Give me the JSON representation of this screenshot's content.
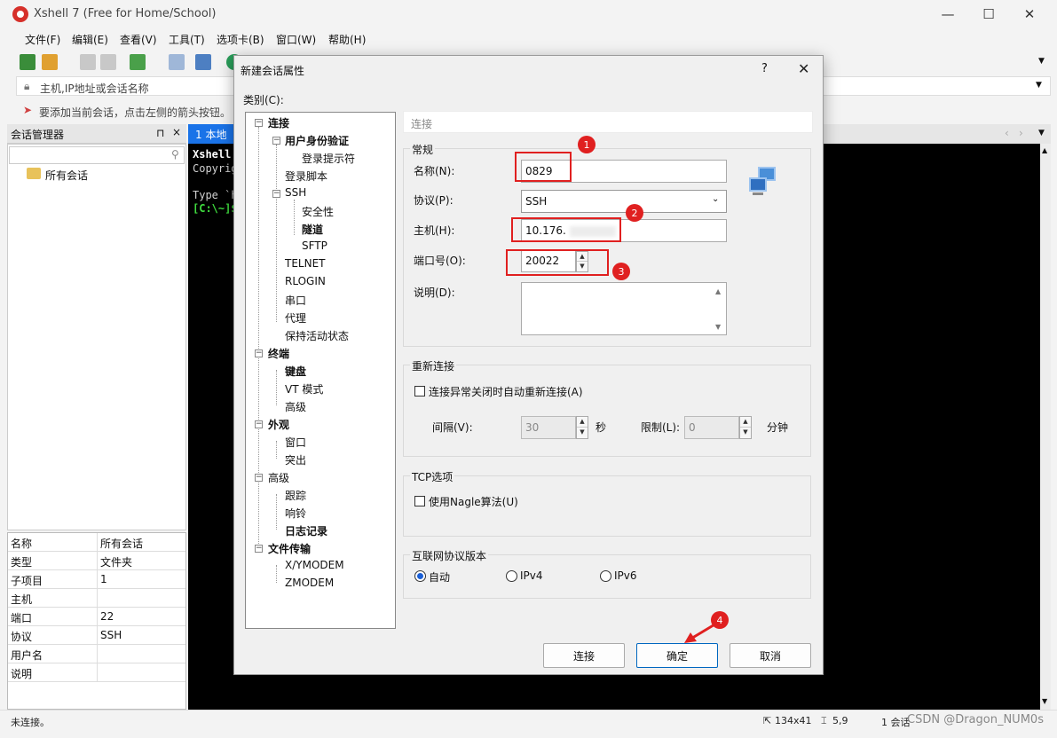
{
  "app": {
    "title": "Xshell 7 (Free for Home/School)",
    "menu": [
      "文件(F)",
      "编辑(E)",
      "查看(V)",
      "工具(T)",
      "选项卡(B)",
      "窗口(W)",
      "帮助(H)"
    ],
    "address_placeholder": "主机,IP地址或会话名称",
    "hint": "要添加当前会话，点击左侧的箭头按钮。"
  },
  "session_manager": {
    "title": "会话管理器",
    "pin": "⊓",
    "close": "×",
    "root": "所有会话",
    "props": [
      {
        "key": "名称",
        "value": "所有会话"
      },
      {
        "key": "类型",
        "value": "文件夹"
      },
      {
        "key": "子项目",
        "value": "1"
      },
      {
        "key": "主机",
        "value": ""
      },
      {
        "key": "端口",
        "value": "22"
      },
      {
        "key": "协议",
        "value": "SSH"
      },
      {
        "key": "用户名",
        "value": ""
      },
      {
        "key": "说明",
        "value": ""
      }
    ]
  },
  "terminal": {
    "tab": "1 本地",
    "lines": [
      "Xshell",
      "Copyrig",
      "",
      "Type `h",
      "[C:\\~]$"
    ]
  },
  "status": {
    "left": "未连接。",
    "size": "134x41",
    "pos": "5,9",
    "sessions": "1 会话",
    "watermark": "CSDN @Dragon_NUM0s",
    "num": "NUM"
  },
  "dialog": {
    "title": "新建会话属性",
    "help": "?",
    "close": "✕",
    "category_label": "类别(C):",
    "tree": [
      {
        "label": "连接",
        "level": 0,
        "bold": true,
        "box": "−"
      },
      {
        "label": "用户身份验证",
        "level": 1,
        "bold": true,
        "box": "−"
      },
      {
        "label": "登录提示符",
        "level": 2,
        "bold": false
      },
      {
        "label": "登录脚本",
        "level": 1,
        "bold": false
      },
      {
        "label": "SSH",
        "level": 1,
        "bold": false,
        "box": "−"
      },
      {
        "label": "安全性",
        "level": 2,
        "bold": false
      },
      {
        "label": "隧道",
        "level": 2,
        "bold": true
      },
      {
        "label": "SFTP",
        "level": 2,
        "bold": false
      },
      {
        "label": "TELNET",
        "level": 1,
        "bold": false
      },
      {
        "label": "RLOGIN",
        "level": 1,
        "bold": false
      },
      {
        "label": "串口",
        "level": 1,
        "bold": false
      },
      {
        "label": "代理",
        "level": 1,
        "bold": false
      },
      {
        "label": "保持活动状态",
        "level": 1,
        "bold": false
      },
      {
        "label": "终端",
        "level": 0,
        "bold": true,
        "box": "−"
      },
      {
        "label": "键盘",
        "level": 1,
        "bold": true
      },
      {
        "label": "VT 模式",
        "level": 1,
        "bold": false
      },
      {
        "label": "高级",
        "level": 1,
        "bold": false
      },
      {
        "label": "外观",
        "level": 0,
        "bold": true,
        "box": "−"
      },
      {
        "label": "窗口",
        "level": 1,
        "bold": false
      },
      {
        "label": "突出",
        "level": 1,
        "bold": false
      },
      {
        "label": "高级",
        "level": 0,
        "bold": false,
        "box": "−"
      },
      {
        "label": "跟踪",
        "level": 1,
        "bold": false
      },
      {
        "label": "响铃",
        "level": 1,
        "bold": false
      },
      {
        "label": "日志记录",
        "level": 1,
        "bold": true
      },
      {
        "label": "文件传输",
        "level": 0,
        "bold": true,
        "box": "−"
      },
      {
        "label": "X/YMODEM",
        "level": 1,
        "bold": false
      },
      {
        "label": "ZMODEM",
        "level": 1,
        "bold": false
      }
    ],
    "breadcrumb": "连接",
    "general": {
      "title": "常规",
      "name_label": "名称(N):",
      "name_value": "0829",
      "protocol_label": "协议(P):",
      "protocol_value": "SSH",
      "host_label": "主机(H):",
      "host_value": "10.176.",
      "port_label": "端口号(O):",
      "port_value": "20022",
      "desc_label": "说明(D):",
      "desc_value": ""
    },
    "reconnect": {
      "title": "重新连接",
      "checkbox": "连接异常关闭时自动重新连接(A)",
      "interval_label": "间隔(V):",
      "interval_value": "30",
      "interval_unit": "秒",
      "limit_label": "限制(L):",
      "limit_value": "0",
      "limit_unit": "分钟"
    },
    "tcp": {
      "title": "TCP选项",
      "checkbox": "使用Nagle算法(U)"
    },
    "ipver": {
      "title": "互联网协议版本",
      "options": [
        "自动",
        "IPv4",
        "IPv6"
      ],
      "selected": "自动"
    },
    "buttons": {
      "connect": "连接",
      "ok": "确定",
      "cancel": "取消"
    },
    "markers": [
      "1",
      "2",
      "3",
      "4"
    ]
  }
}
